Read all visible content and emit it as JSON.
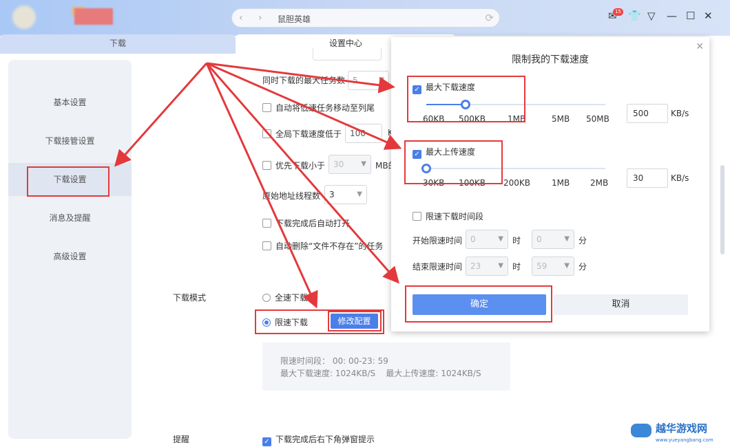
{
  "header": {
    "address": "鼠胆英雄",
    "badge_count": "15"
  },
  "tabs": [
    {
      "label": "下载"
    },
    {
      "label": "设置中心"
    }
  ],
  "sidebar": {
    "items": [
      {
        "label": "基本设置"
      },
      {
        "label": "下载接管设置"
      },
      {
        "label": "下载设置",
        "selected": true
      },
      {
        "label": "消息及提醒"
      },
      {
        "label": "高级设置"
      }
    ]
  },
  "settings": {
    "max_tasks_label": "同时下载的最大任务数",
    "max_tasks_value": "5",
    "auto_move_label": "自动将低速任务移动至列尾",
    "global_speed_label": "全局下载速度低于",
    "global_speed_value": "100",
    "global_speed_unit": "K",
    "priority_label": "优先下载小于",
    "priority_value": "30",
    "priority_unit": "MB的",
    "threads_label": "原始地址线程数",
    "threads_value": "3",
    "auto_open_label": "下载完成后自动打开",
    "auto_delete_label": "自动删除“文件不存在”的任务",
    "mode_label": "下载模式",
    "mode_full": "全速下载",
    "mode_limited": "限速下载",
    "modify_button": "修改配置",
    "info_line1": "限速时间段： 00: 00-23: 59",
    "info_line2": "最大下载速度: 1024KB/S    最大上传速度: 1024KB/S",
    "remind_label": "提醒",
    "remind_popup": "下载完成后右下角弹窗提示"
  },
  "dialog": {
    "title": "限制我的下载速度",
    "download": {
      "label": "最大下载速度",
      "checked": true,
      "ticks": [
        "60KB",
        "500KB",
        "1MB",
        "5MB",
        "50MB"
      ],
      "value": "500",
      "unit": "KB/s",
      "position": 0.22
    },
    "upload": {
      "label": "最大上传速度",
      "checked": true,
      "ticks": [
        "30KB",
        "100KB",
        "200KB",
        "1MB",
        "2MB"
      ],
      "value": "30",
      "unit": "KB/s",
      "position": 0.0
    },
    "time_label": "限速下载时间段",
    "start_label": "开始限速时间",
    "end_label": "结束限速时间",
    "start_hour": "0",
    "start_min": "0",
    "end_hour": "23",
    "end_min": "59",
    "hour_unit": "时",
    "min_unit": "分",
    "ok": "确定",
    "cancel": "取消"
  },
  "watermark": {
    "text": "越华游戏网",
    "url": "www.yueyangbang.com"
  },
  "colors": {
    "accent": "#4a7fe8",
    "highlight": "#e4393c"
  }
}
